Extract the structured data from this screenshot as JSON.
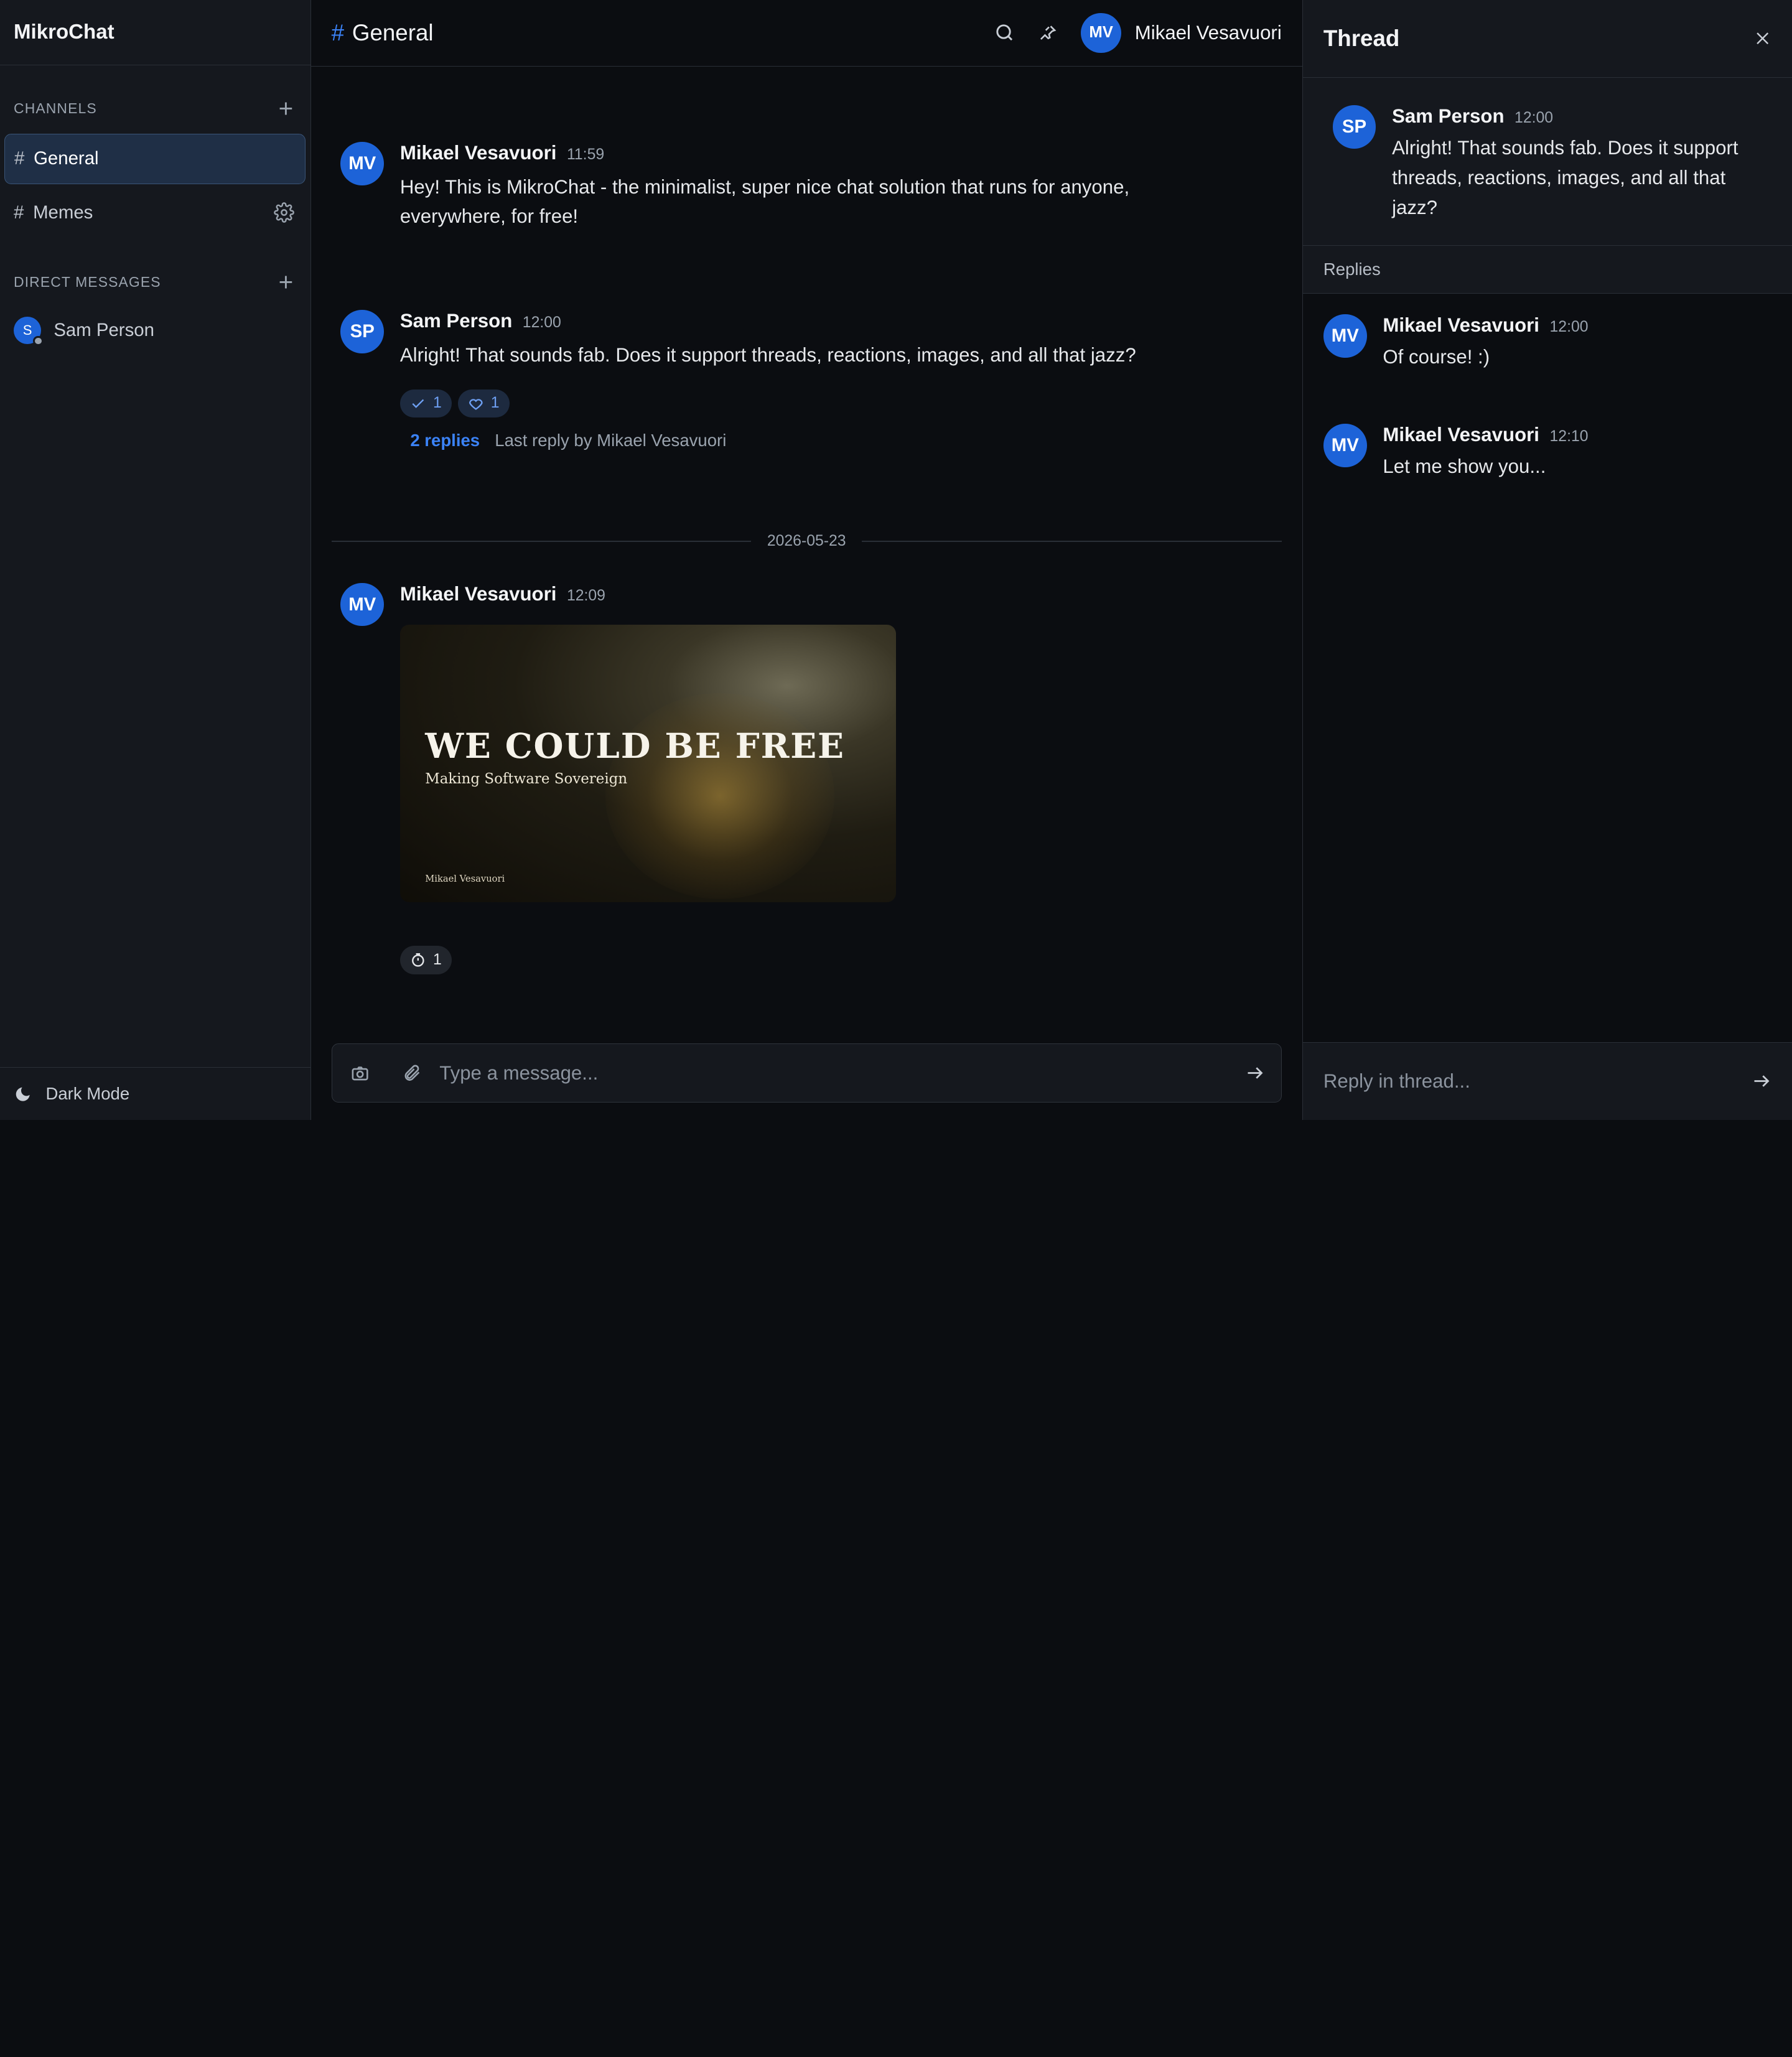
{
  "app": {
    "name": "MikroChat"
  },
  "sidebar": {
    "channels_header": "CHANNELS",
    "channels": [
      {
        "hash": "#",
        "label": "General",
        "active": true
      },
      {
        "hash": "#",
        "label": "Memes",
        "active": false
      }
    ],
    "dm_header": "DIRECT MESSAGES",
    "dms": [
      {
        "initial": "S",
        "label": "Sam Person"
      }
    ],
    "footer_label": "Dark Mode"
  },
  "header": {
    "hash": "#",
    "channel": "General",
    "user_initials": "MV",
    "user_name": "Mikael Vesavuori"
  },
  "messages": [
    {
      "initials": "MV",
      "author": "Mikael Vesavuori",
      "time": "11:59",
      "text": "Hey! This is MikroChat - the minimalist, super nice chat solution that runs for anyone, everywhere, for free!"
    },
    {
      "initials": "SP",
      "author": "Sam Person",
      "time": "12:00",
      "text": "Alright! That sounds fab. Does it support threads, reactions, images, and all that jazz?",
      "reactions": [
        {
          "icon": "check-icon",
          "count": "1"
        },
        {
          "icon": "heart-icon",
          "count": "1"
        }
      ],
      "replies_count": "2 replies",
      "last_reply": "Last reply by Mikael Vesavuori"
    },
    {
      "initials": "MV",
      "author": "Mikael Vesavuori",
      "time": "12:09",
      "image": {
        "headline": "WE COULD BE FREE",
        "subtitle": "Making Software Sovereign",
        "signature": "Mikael Vesavuori"
      },
      "reactions": [
        {
          "icon": "timer-icon",
          "count": "1"
        }
      ]
    }
  ],
  "date_divider": "2026-05-23",
  "composer": {
    "placeholder": "Type a message..."
  },
  "thread": {
    "title": "Thread",
    "parent": {
      "initials": "SP",
      "author": "Sam Person",
      "time": "12:00",
      "text": "Alright! That sounds fab. Does it support threads, reactions, images, and all that jazz?"
    },
    "replies_label": "Replies",
    "replies": [
      {
        "initials": "MV",
        "author": "Mikael Vesavuori",
        "time": "12:00",
        "text": "Of course! :)"
      },
      {
        "initials": "MV",
        "author": "Mikael Vesavuori",
        "time": "12:10",
        "text": "Let me show you..."
      }
    ],
    "composer_placeholder": "Reply in thread..."
  },
  "colors": {
    "accent": "#3b82f6",
    "avatar": "#1d63d8",
    "background": "#0b0d11",
    "panel": "#15181e"
  }
}
